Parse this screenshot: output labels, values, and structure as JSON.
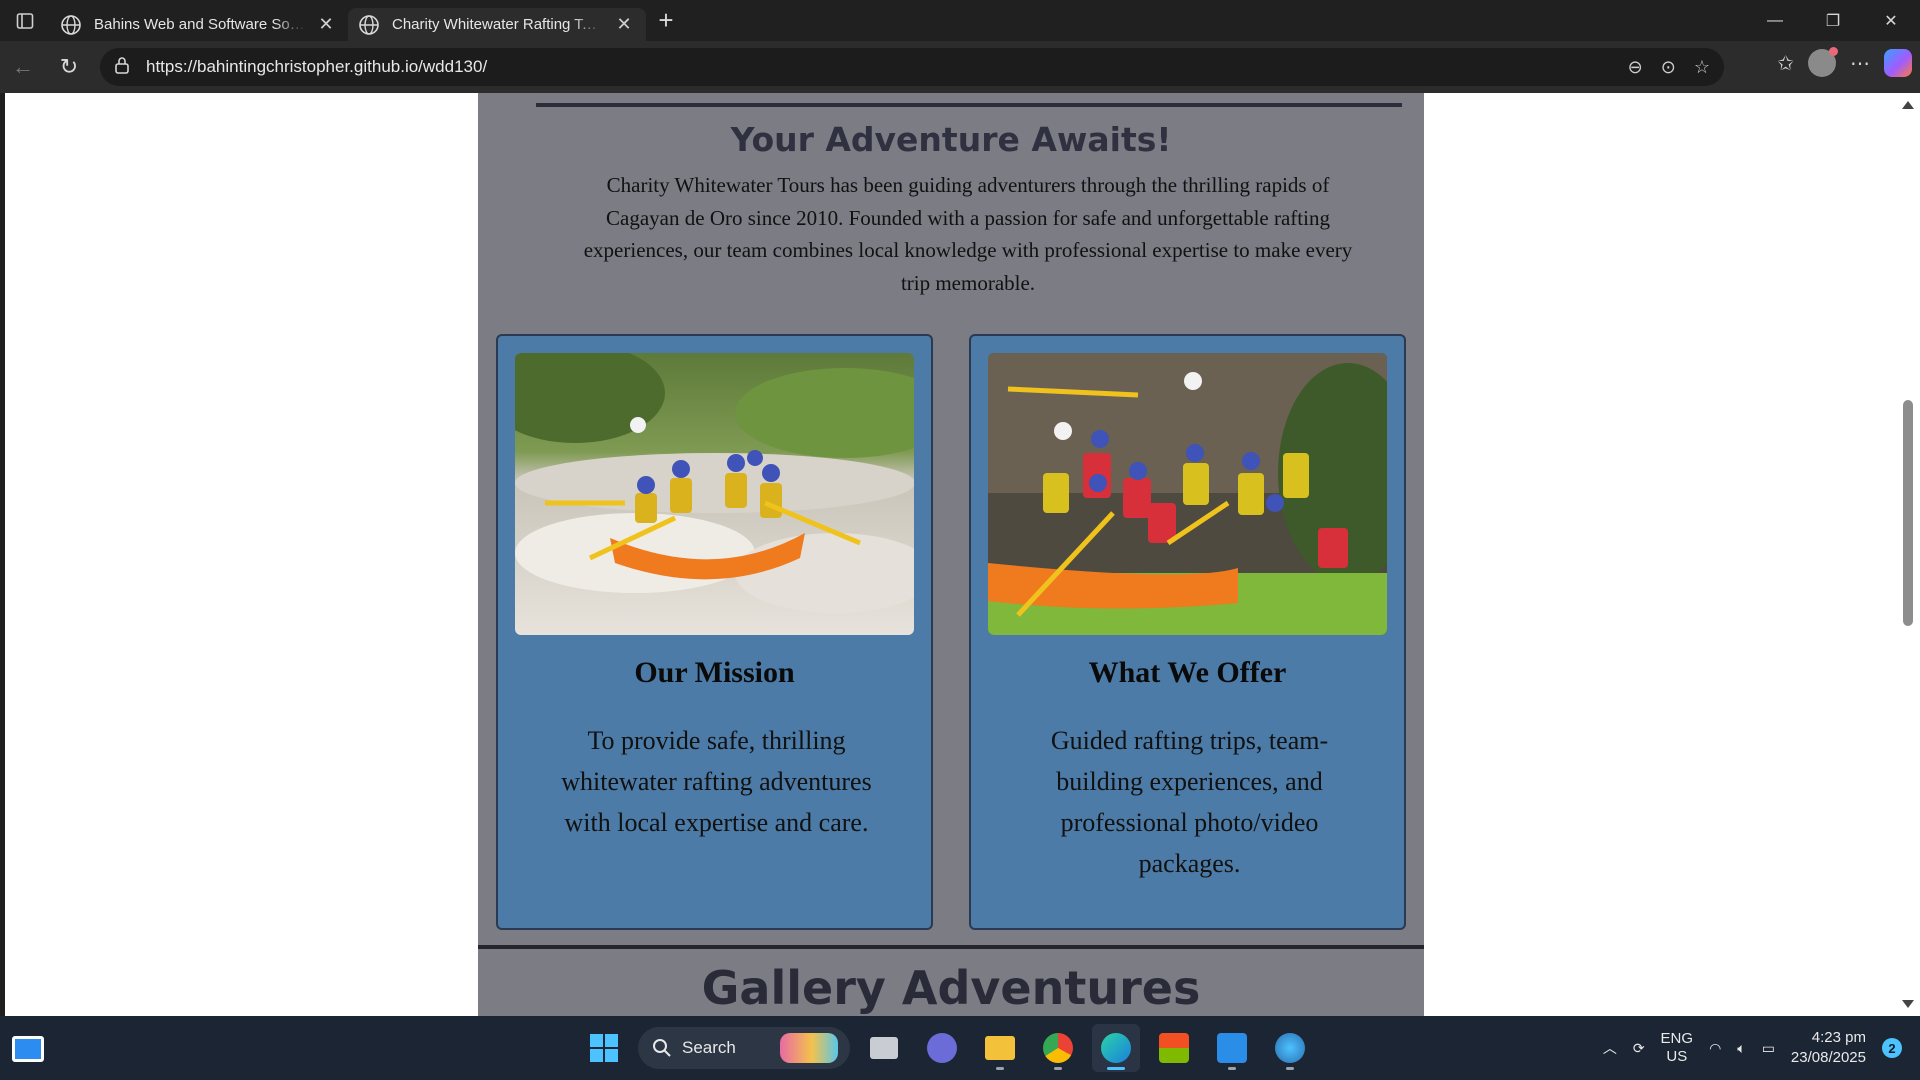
{
  "browser": {
    "tabs": [
      {
        "title": "Bahins Web and Software Solutions",
        "active": false
      },
      {
        "title": "Charity Whitewater Rafting Tours",
        "active": true
      }
    ],
    "new_tab": "+",
    "url": "https://bahintingchristopher.github.io/wdd130/"
  },
  "page": {
    "section_title": "Your Adventure Awaits!",
    "intro": "Charity Whitewater Tours has been guiding adventurers through the thrilling rapids of Cagayan de Oro since 2010. Founded with a passion for safe and unforgettable rafting experiences, our team combines local knowledge with professional expertise to make every trip memorable.",
    "cards": [
      {
        "title": "Our Mission",
        "text": "To provide safe, thrilling whitewater rafting adventures with local expertise and care."
      },
      {
        "title": "What We Offer",
        "text": "Guided rafting trips, team-building experiences, and professional photo/video packages."
      }
    ],
    "next_section_title": "Gallery Adventures"
  },
  "taskbar": {
    "search_label": "Search",
    "lang_line1": "ENG",
    "lang_line2": "US",
    "time": "4:23 pm",
    "date": "23/08/2025",
    "notification_count": "2"
  },
  "colors": {
    "container_bg": "#7b7c84",
    "card_bg": "#4b7ba6",
    "heading": "#2f3040"
  }
}
